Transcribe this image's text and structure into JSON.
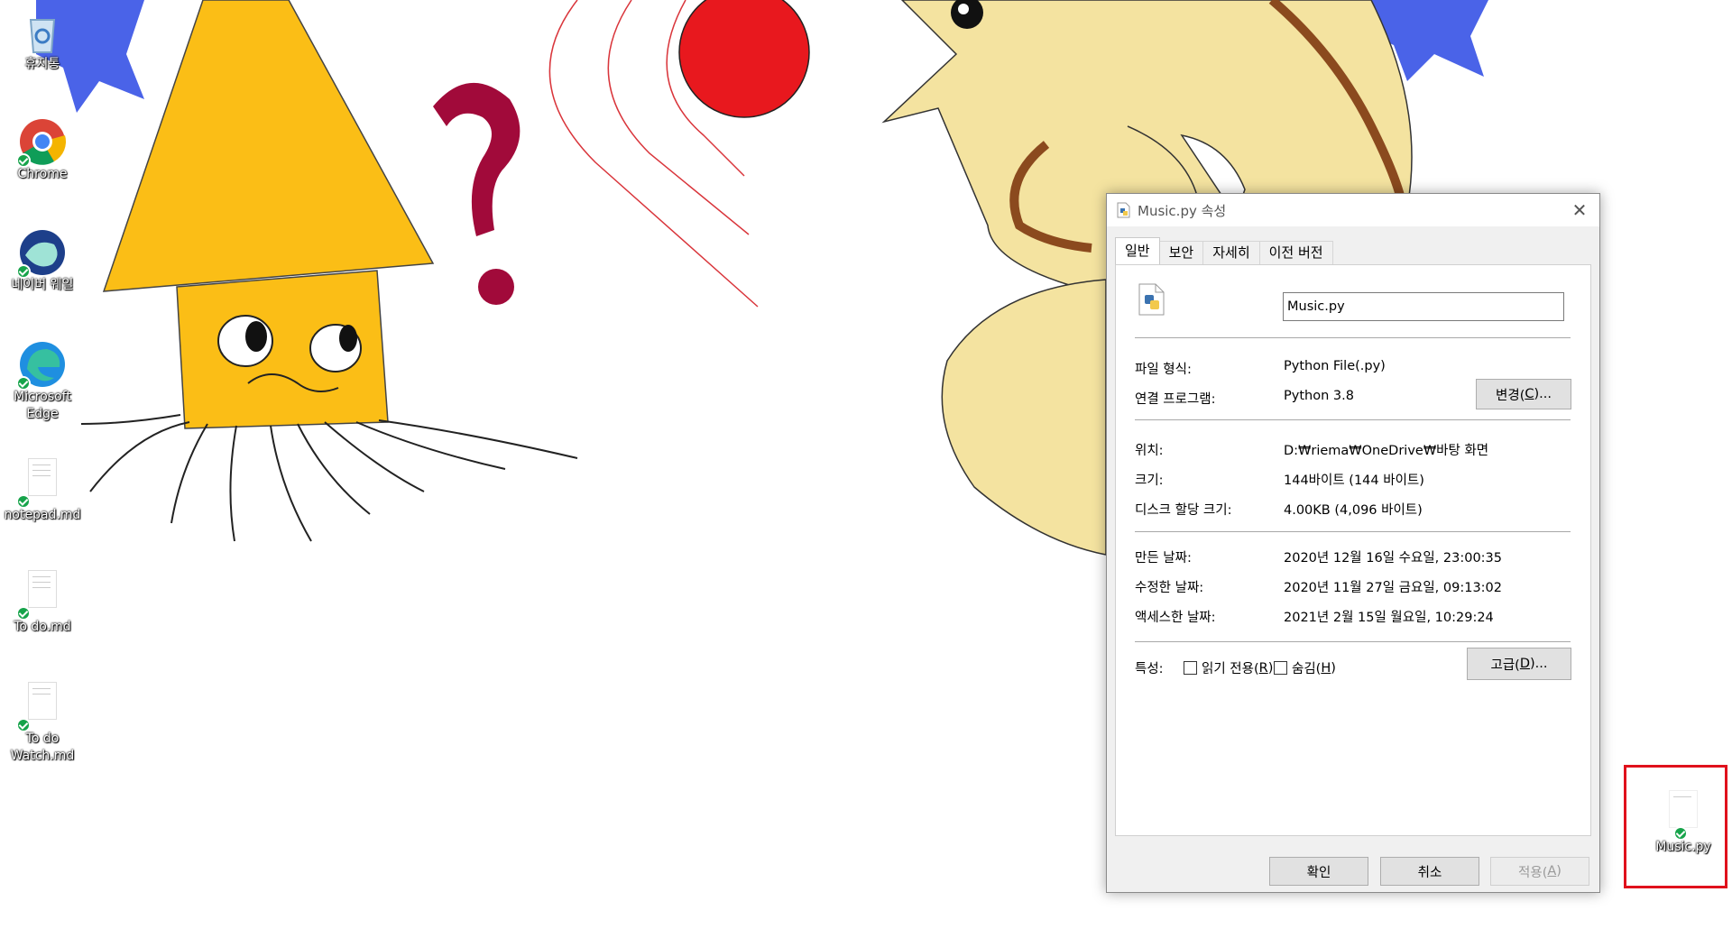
{
  "desktop": {
    "icons": [
      {
        "label": "휴지통"
      },
      {
        "label": "Chrome"
      },
      {
        "label": "네이버 웨일"
      },
      {
        "label": "Microsoft Edge"
      },
      {
        "label": "notepad.md"
      },
      {
        "label": "To do.md"
      },
      {
        "label": "To do Watch.md"
      },
      {
        "label": "Music.py"
      }
    ]
  },
  "dialog": {
    "title": "Music.py 속성",
    "tabs": [
      "일반",
      "보안",
      "자세히",
      "이전 버전"
    ],
    "filename": "Music.py",
    "rows": {
      "type_label": "파일 형식:",
      "type_value": "Python File(.py)",
      "app_label": "연결 프로그램:",
      "app_value": "Python 3.8",
      "location_label": "위치:",
      "location_value": "D:₩riema₩OneDrive₩바탕 화면",
      "size_label": "크기:",
      "size_value": "144바이트 (144 바이트)",
      "disk_label": "디스크 할당 크기:",
      "disk_value": "4.00KB (4,096 바이트)",
      "created_label": "만든 날짜:",
      "created_value": "2020년 12월 16일 수요일, 23:00:35",
      "modified_label": "수정한 날짜:",
      "modified_value": "2020년 11월 27일 금요일, 09:13:02",
      "accessed_label": "액세스한 날짜:",
      "accessed_value": "2021년 2월 15일 월요일, 10:29:24",
      "attr_label": "특성:"
    },
    "change_button": {
      "text": "변경(",
      "key": "C",
      "suffix": ")..."
    },
    "readonly": {
      "text": "읽기 전용(",
      "key": "R",
      "suffix": ")"
    },
    "hidden": {
      "text": "숨김(",
      "key": "H",
      "suffix": ")"
    },
    "advanced_button": {
      "text": "고급(",
      "key": "D",
      "suffix": ")..."
    },
    "ok": "확인",
    "cancel": "취소",
    "apply": {
      "text": "적용(",
      "key": "A",
      "suffix": ")"
    }
  },
  "colors": {
    "highlight": "#e0111c",
    "sync": "#16a34a",
    "accent": "#0078d7"
  }
}
